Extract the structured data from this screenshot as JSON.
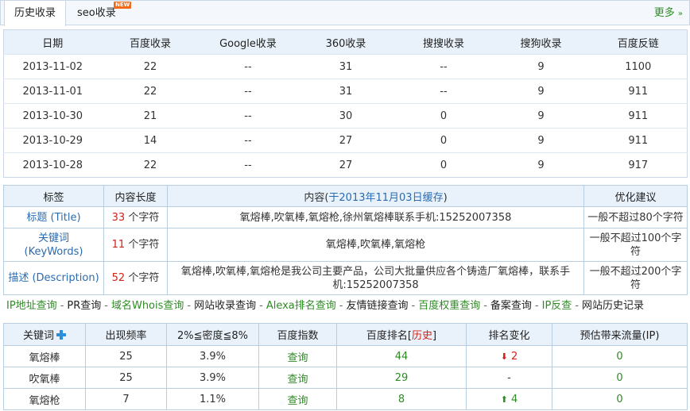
{
  "tabs": [
    {
      "label": "历史收录"
    },
    {
      "label": "seo收录"
    }
  ],
  "new_badge": "NEW",
  "more": {
    "label": "更多",
    "arrow": "»"
  },
  "history": {
    "headers": [
      "日期",
      "百度收录",
      "Google收录",
      "360收录",
      "搜搜收录",
      "搜狗收录",
      "百度反链"
    ],
    "rows": [
      [
        "2013-11-02",
        "22",
        "--",
        "31",
        "--",
        "9",
        "1100"
      ],
      [
        "2013-11-01",
        "22",
        "--",
        "31",
        "--",
        "9",
        "911"
      ],
      [
        "2013-10-30",
        "21",
        "--",
        "30",
        "0",
        "9",
        "911"
      ],
      [
        "2013-10-29",
        "14",
        "--",
        "27",
        "0",
        "9",
        "911"
      ],
      [
        "2013-10-28",
        "22",
        "--",
        "27",
        "0",
        "9",
        "917"
      ]
    ]
  },
  "meta": {
    "headers": {
      "tag": "标签",
      "length": "内容长度",
      "content_prefix": "内容(",
      "content_cache": "于2013年11月03日缓存",
      "content_suffix": ")",
      "advice": "优化建议"
    },
    "unit": "个字符",
    "rows": [
      {
        "label": "标题 (Title)",
        "count": "33",
        "content": "氧熔棒,吹氧棒,氧熔枪,徐州氧熔棒联系手机:15252007358",
        "advice": "一般不超过80个字符"
      },
      {
        "label": "关键词 (KeyWords)",
        "count": "11",
        "content": "氧熔棒,吹氧棒,氧熔枪",
        "advice": "一般不超过100个字符"
      },
      {
        "label": "描述 (Description)",
        "count": "52",
        "content": "氧熔棒,吹氧棒,氧熔枪是我公司主要产品，公司大批量供应各个铸造厂氧熔棒，联系手机:15252007358",
        "advice": "一般不超过200个字符"
      }
    ]
  },
  "links": [
    {
      "label": "IP地址查询",
      "style": "green"
    },
    {
      "label": "PR查询",
      "style": "dark"
    },
    {
      "label": "域名Whois查询",
      "style": "green"
    },
    {
      "label": "网站收录查询",
      "style": "dark"
    },
    {
      "label": "Alexa排名查询",
      "style": "green"
    },
    {
      "label": "友情链接查询",
      "style": "dark"
    },
    {
      "label": "百度权重查询",
      "style": "green"
    },
    {
      "label": "备案查询",
      "style": "dark"
    },
    {
      "label": "IP反查",
      "style": "green"
    },
    {
      "label": "网站历史记录",
      "style": "dark"
    }
  ],
  "keywords": {
    "headers": {
      "keyword": "关键词",
      "freq": "出现频率",
      "density": "2%≦密度≦8%",
      "index": "百度指数",
      "rank_prefix": "百度排名[",
      "rank_history": "历史",
      "rank_suffix": "]",
      "change": "排名变化",
      "traffic": "预估带来流量(IP)"
    },
    "rows": [
      {
        "keyword": "氧熔棒",
        "freq": "25",
        "density": "3.9%",
        "index": "查询",
        "rank": "44",
        "change_dir": "down",
        "change": "2",
        "traffic": "0"
      },
      {
        "keyword": "吹氧棒",
        "freq": "25",
        "density": "3.9%",
        "index": "查询",
        "rank": "29",
        "change_dir": "none",
        "change": "-",
        "traffic": "0"
      },
      {
        "keyword": "氧熔枪",
        "freq": "7",
        "density": "1.1%",
        "index": "查询",
        "rank": "8",
        "change_dir": "up",
        "change": "4",
        "traffic": "0"
      }
    ]
  }
}
